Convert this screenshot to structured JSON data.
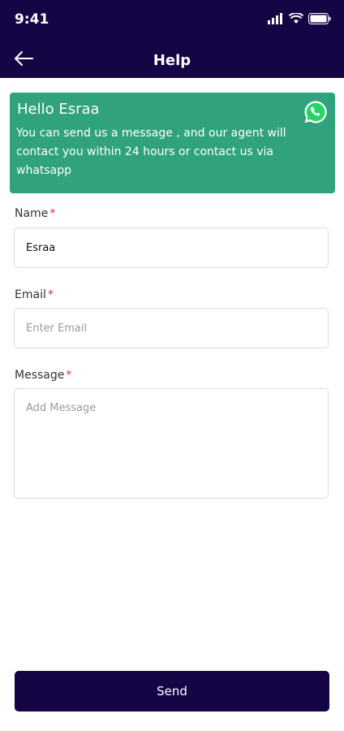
{
  "status_bar": {
    "time": "9:41"
  },
  "appbar": {
    "title": "Help"
  },
  "banner": {
    "title": "Hello Esraa",
    "text": "You can send us a message , and our agent will contact you within 24 hours or contact us via whatsapp",
    "icon": "whatsapp-icon",
    "color": "#30a27c"
  },
  "form": {
    "name": {
      "label": "Name",
      "required_mark": "*",
      "value": "Esraa",
      "placeholder": ""
    },
    "email": {
      "label": "Email",
      "required_mark": "*",
      "value": "",
      "placeholder": "Enter Email"
    },
    "message": {
      "label": "Message",
      "required_mark": "*",
      "value": "",
      "placeholder": "Add Message"
    }
  },
  "send_button": {
    "label": "Send"
  },
  "colors": {
    "primary": "#160544",
    "accent": "#30a27c",
    "required": "#d93636"
  }
}
